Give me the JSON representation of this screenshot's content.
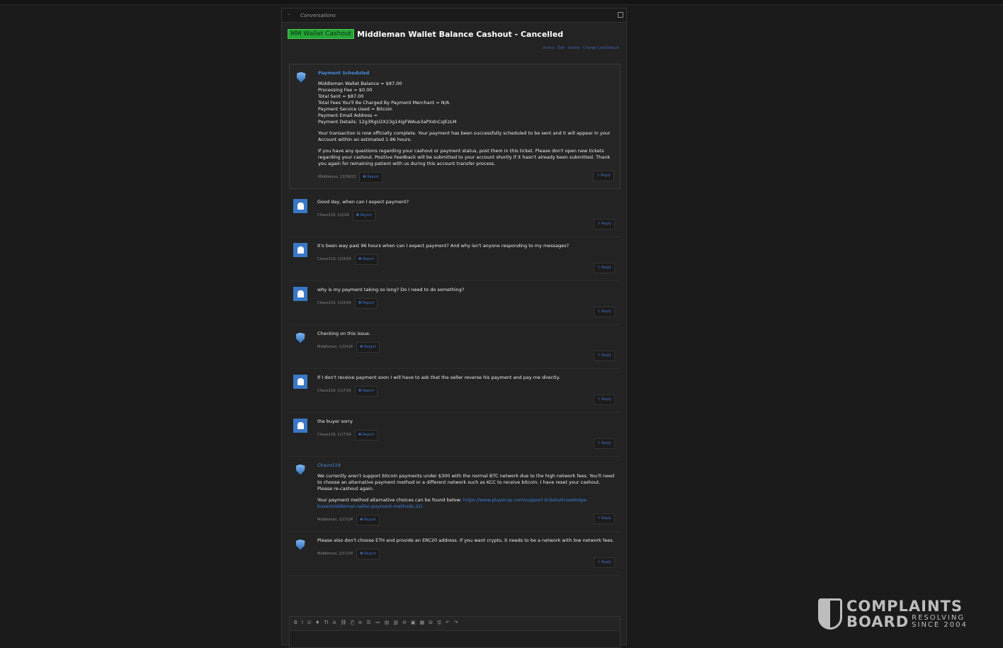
{
  "breadcrumb": {
    "item": "Conversations"
  },
  "thread": {
    "prefix": "MM Wallet Cashout",
    "title": "Middleman Wallet Balance Cashout - Cancelled",
    "links": "Unlock · Edit · Delete · Change Live/Default"
  },
  "messages": [
    {
      "avatar": "shield",
      "head": "Payment Scheduled",
      "paragraphs": [
        "Middleman Wallet Balance = $87.00\nProcessing Fee = $0.00\nTotal Sent = $87.00\nTotal Fees You'll Be Charged By Payment Merchant = N/A\nPayment Service Used = Bitcoin\nPayment Email Address =\nPayment Details: 12g3RgU2X23g14igFWAus3aPXdnCsJEzLM",
        "Your transaction is now officially complete. Your payment has been successfully scheduled to be sent and it will appear in your Account within an estimated 1-96 hours.",
        "If you have any questions regarding your cashout or payment status, post them in this ticket. Please don't open new tickets regarding your cashout. Positive Feedback will be submitted to your account shortly if it hasn't already been submitted. Thank you again for remaining patient with us during this account transfer process."
      ],
      "meta": "Middleman, 12/24/23"
    },
    {
      "avatar": "user",
      "paragraphs": [
        "Good day, when can I expect payment?"
      ],
      "meta": "Chavo119, 1/2/24"
    },
    {
      "avatar": "user",
      "paragraphs": [
        "It's been way past 96 hours when can I expect payment? And why isn't anyone responding to my messages?"
      ],
      "meta": "Chavo119, 1/10/24"
    },
    {
      "avatar": "user",
      "paragraphs": [
        "why is my payment taking so long? Do I need to do something?"
      ],
      "meta": "Chavo119, 1/15/24"
    },
    {
      "avatar": "shield",
      "paragraphs": [
        "Checking on this issue."
      ],
      "meta": "Middleman, 1/15/24"
    },
    {
      "avatar": "user",
      "paragraphs": [
        "If I don't receive payment soon I will have to ask that the seller reverse his payment and pay me directly."
      ],
      "meta": "Chavo119, 1/17/24"
    },
    {
      "avatar": "user",
      "paragraphs": [
        "the buyer sorry"
      ],
      "meta": "Chavo119, 1/17/24"
    },
    {
      "avatar": "shield",
      "mention": "Chavo119",
      "paragraphs": [
        "We currently aren't support bitcoin payments under $300 with the normal BTC network due to the high network fees. You'll need to choose an alternative payment method or a different network such as KCC to receive bitcoin. I have reset your cashout. Please re-cashout again.",
        "Your payment method alternative choices can be found below: "
      ],
      "link": "https://www.playerup.com/support-tickets/knowledge-base/middleman-seller-payment-methods.22/",
      "meta": "Middleman, 1/17/24"
    },
    {
      "avatar": "shield",
      "paragraphs": [
        "Please also don't choose ETH and provide an ERC20 address. If you want crypto, it needs to be a network with low network fees."
      ],
      "meta": "Middleman, 1/17/24"
    }
  ],
  "buttons": {
    "report": "❶ Report",
    "reply": "↰ Reply"
  },
  "editor": {
    "tools": [
      "B",
      "I",
      "U",
      "♦",
      "TI",
      "A",
      "⛓",
      "⛓̸",
      "≡",
      "☰",
      "≔",
      "▤",
      "▥",
      "⊖",
      "▣",
      "▦",
      "⊟",
      "🖫",
      "↶",
      "↷"
    ]
  },
  "watermark": {
    "line1": "COMPLAINTS",
    "line2": "BOARD",
    "tag1": "RESOLVING",
    "tag2": "SINCE 2004"
  }
}
